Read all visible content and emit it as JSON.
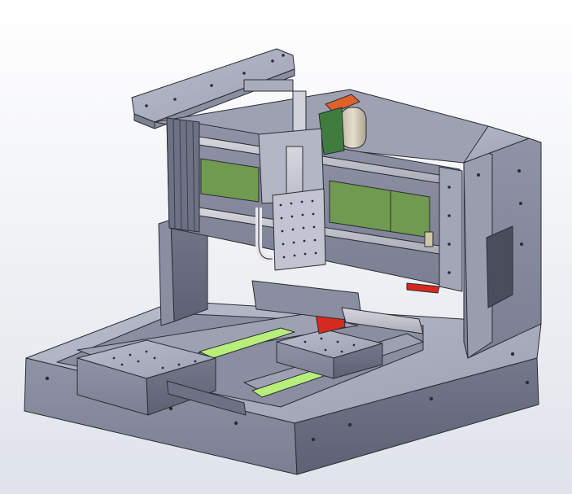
{
  "scene": {
    "subject": "cad-render",
    "colors": {
      "background_top": "#ffffff",
      "background_bottom": "#dfe3ea",
      "steel_light": "#a9acbb",
      "steel_mid": "#8e91a2",
      "steel_dark": "#6e7183",
      "edge": "#2a2c34",
      "pcb_green": "#6f9a4f",
      "bright_green": "#b7ef7a",
      "accent_red": "#d62a1f",
      "accent_orange": "#e0612a",
      "motor_tan": "#cfc7b3",
      "mount_green": "#3f7d3e"
    }
  }
}
